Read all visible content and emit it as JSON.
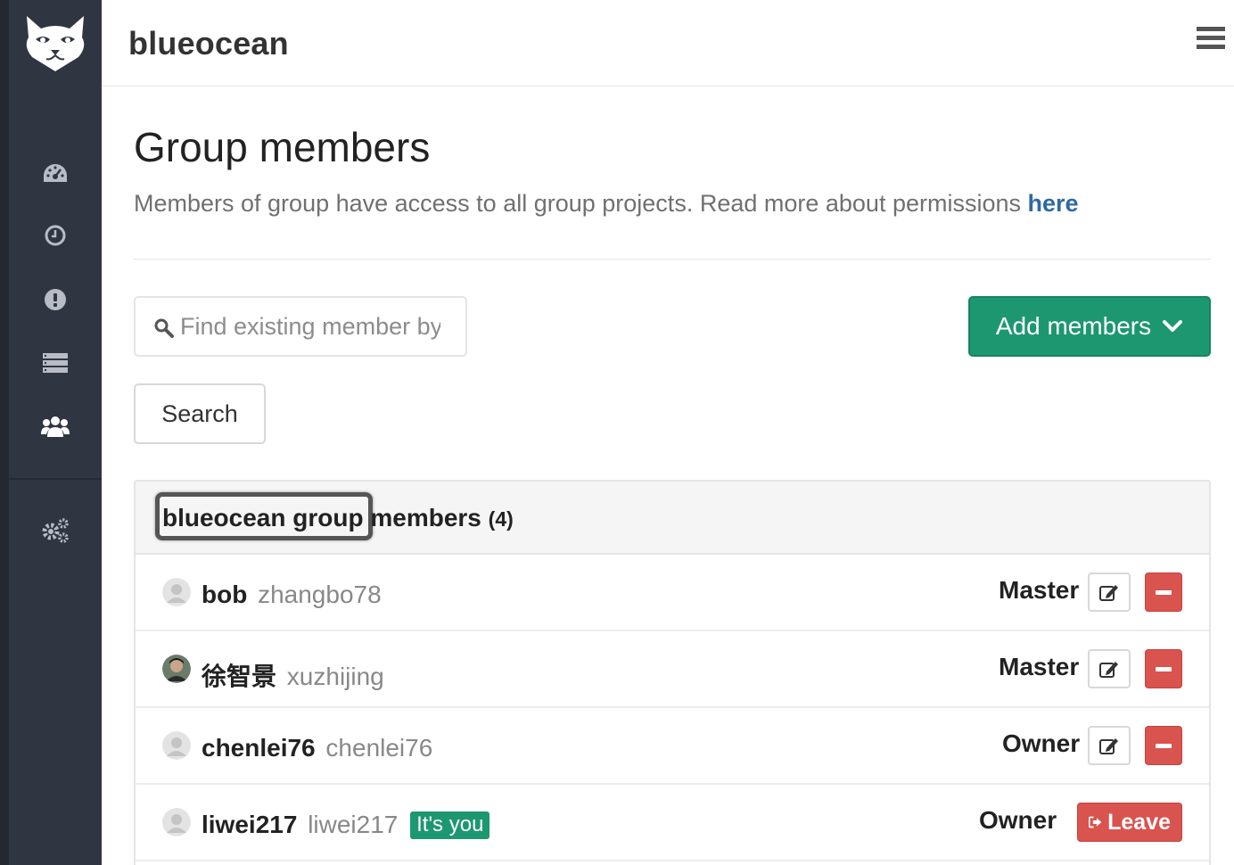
{
  "app": {
    "title": "blueocean",
    "logo_icon": "gitlab-fox-logo-icon",
    "menu_icon": "hamburger-menu-icon"
  },
  "sidebar": {
    "items": [
      {
        "icon": "dashboard-icon",
        "active": false
      },
      {
        "icon": "clock-icon",
        "active": false
      },
      {
        "icon": "exclamation-icon",
        "active": false
      },
      {
        "icon": "list-icon",
        "active": false
      },
      {
        "icon": "users-icon",
        "active": true
      },
      {
        "icon": "cogs-icon",
        "active": false
      }
    ]
  },
  "page": {
    "title": "Group members",
    "lead_text": "Members of group have access to all group projects. Read more about permissions",
    "lead_link": "here"
  },
  "search": {
    "placeholder": "Find existing member by name",
    "button_label": "Search"
  },
  "add_members": {
    "label": "Add members",
    "color": "#1d9770"
  },
  "panel": {
    "group_name": "blueocean group",
    "members_word": "members",
    "count": "(4)"
  },
  "members": [
    {
      "name": "bob",
      "username": "zhangbo78",
      "role": "Master",
      "badge": "",
      "action": "remove",
      "avatar": "default-avatar-icon"
    },
    {
      "name": "徐智景",
      "username": "xuzhijing",
      "role": "Master",
      "badge": "",
      "action": "remove",
      "avatar": "user-photo-avatar"
    },
    {
      "name": "chenlei76",
      "username": "chenlei76",
      "role": "Owner",
      "badge": "",
      "action": "remove",
      "avatar": "default-avatar-icon"
    },
    {
      "name": "liwei217",
      "username": "liwei217",
      "role": "Owner",
      "badge": "It's you",
      "action": "leave",
      "action_label": "Leave",
      "avatar": "default-avatar-icon"
    }
  ],
  "colors": {
    "sidebar": "#303641",
    "danger": "#d9534f",
    "success": "#1d9770",
    "link": "#2e69a8"
  }
}
